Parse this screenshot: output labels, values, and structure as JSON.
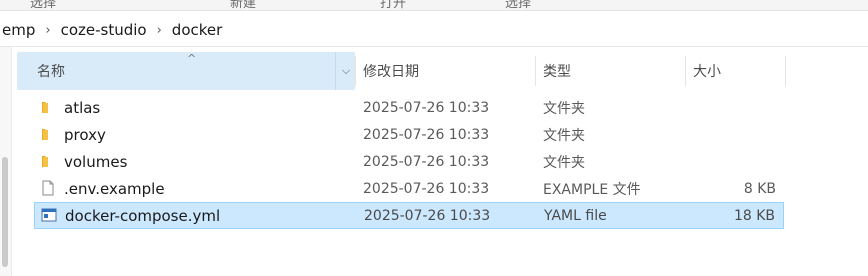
{
  "ribbon": {
    "items": [
      "选择",
      "新建",
      "打开",
      "选择"
    ]
  },
  "address": {
    "crumbs": [
      "emp",
      "coze-studio",
      "docker"
    ],
    "separator": "›"
  },
  "columns": {
    "name": "名称",
    "date": "修改日期",
    "type": "类型",
    "size": "大小",
    "sort_glyph": "^",
    "chevron": "⌵"
  },
  "files": [
    {
      "name": "atlas",
      "date": "2025-07-26 10:33",
      "type": "文件夹",
      "size": "",
      "icon": "folder-icon"
    },
    {
      "name": "proxy",
      "date": "2025-07-26 10:33",
      "type": "文件夹",
      "size": "",
      "icon": "folder-icon"
    },
    {
      "name": "volumes",
      "date": "2025-07-26 10:33",
      "type": "文件夹",
      "size": "",
      "icon": "folder-icon"
    },
    {
      "name": ".env.example",
      "date": "2025-07-26 10:33",
      "type": "EXAMPLE 文件",
      "size": "8 KB",
      "icon": "file-icon"
    },
    {
      "name": "docker-compose.yml",
      "date": "2025-07-26 10:33",
      "type": "YAML file",
      "size": "18 KB",
      "icon": "yaml-file-icon",
      "selected": true
    }
  ],
  "colors": {
    "selection_bg": "#cce8ff",
    "selection_border": "#99d1ff",
    "header_highlight": "#d9ebf9",
    "folder": "#f3c244"
  }
}
